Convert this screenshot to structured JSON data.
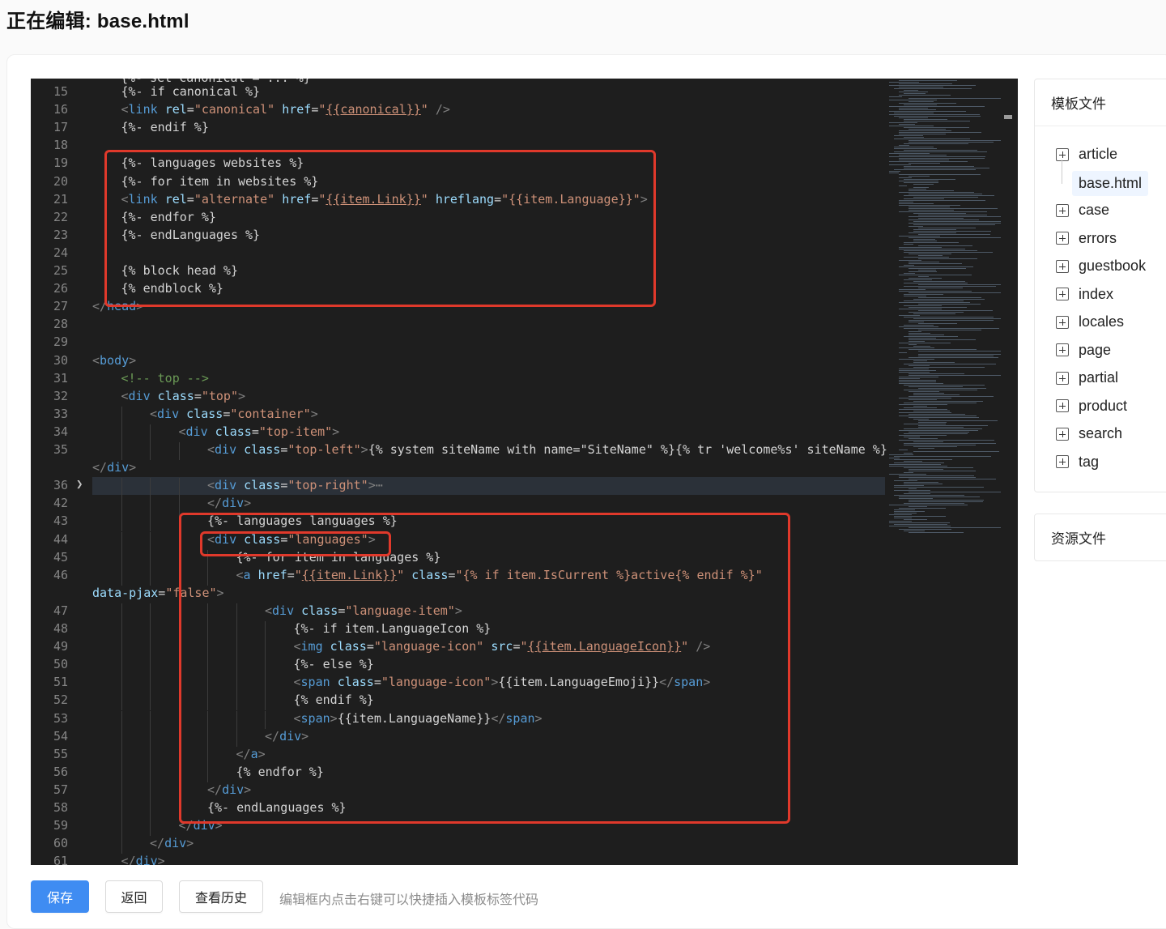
{
  "header": {
    "title": "正在编辑: base.html"
  },
  "editor": {
    "lines": [
      {
        "n": "15",
        "indent": 1,
        "html": "{%- if canonical %}"
      },
      {
        "n": "16",
        "indent": 1,
        "html": "<span class='p'>&lt;</span><span class='t'>link</span> <span class='a'>rel</span>=<span class='s'>\"canonical\"</span> <span class='a'>href</span>=<span class='s'>\"<span class='u'>{{canonical}}</span>\"</span> <span class='p'>/&gt;</span>"
      },
      {
        "n": "17",
        "indent": 1,
        "html": "{%- endif %}"
      },
      {
        "n": "18",
        "indent": 0,
        "html": ""
      },
      {
        "n": "19",
        "indent": 1,
        "html": "{%- languages websites %}"
      },
      {
        "n": "20",
        "indent": 1,
        "html": "{%- for item in websites %}"
      },
      {
        "n": "21",
        "indent": 1,
        "html": "<span class='p'>&lt;</span><span class='t'>link</span> <span class='a'>rel</span>=<span class='s'>\"alternate\"</span> <span class='a'>href</span>=<span class='s'>\"<span class='u'>{{item.Link}}</span>\"</span> <span class='a'>hreflang</span>=<span class='s'>\"{{item.Language}}\"</span><span class='p'>&gt;</span>"
      },
      {
        "n": "22",
        "indent": 1,
        "html": "{%- endfor %}"
      },
      {
        "n": "23",
        "indent": 1,
        "html": "{%- endLanguages %}"
      },
      {
        "n": "24",
        "indent": 0,
        "html": ""
      },
      {
        "n": "25",
        "indent": 1,
        "html": "{% block head %}"
      },
      {
        "n": "26",
        "indent": 1,
        "html": "{% endblock %}"
      },
      {
        "n": "27",
        "indent": 0,
        "html": "<span class='p'>&lt;/</span><span class='t'>head</span><span class='p'>&gt;</span>"
      },
      {
        "n": "28",
        "indent": 0,
        "html": ""
      },
      {
        "n": "29",
        "indent": 0,
        "html": ""
      },
      {
        "n": "30",
        "indent": 0,
        "html": "<span class='p'>&lt;</span><span class='t'>body</span><span class='p'>&gt;</span>"
      },
      {
        "n": "31",
        "indent": 1,
        "html": "<span class='c'>&lt;!-- top --&gt;</span>"
      },
      {
        "n": "32",
        "indent": 1,
        "html": "<span class='p'>&lt;</span><span class='t'>div</span> <span class='a'>class</span>=<span class='s'>\"top\"</span><span class='p'>&gt;</span>"
      },
      {
        "n": "33",
        "indent": 2,
        "html": "<span class='p'>&lt;</span><span class='t'>div</span> <span class='a'>class</span>=<span class='s'>\"container\"</span><span class='p'>&gt;</span>"
      },
      {
        "n": "34",
        "indent": 3,
        "html": "<span class='p'>&lt;</span><span class='t'>div</span> <span class='a'>class</span>=<span class='s'>\"top-item\"</span><span class='p'>&gt;</span>"
      },
      {
        "n": "35",
        "indent": 4,
        "html": "<span class='p'>&lt;</span><span class='t'>div</span> <span class='a'>class</span>=<span class='s'>\"top-left\"</span><span class='p'>&gt;</span>{% system siteName with name=\"SiteName\" %}{% tr 'welcome%s' siteName %}"
      },
      {
        "n": "",
        "indent": 0,
        "html": "<span class='p'>&lt;/</span><span class='t'>div</span><span class='p'>&gt;</span>"
      },
      {
        "n": "36",
        "indent": 4,
        "fold": true,
        "html": "<span class='p'>&lt;</span><span class='t'>div</span> <span class='a'>class</span>=<span class='s'>\"top-right\"</span><span class='p'>&gt;</span><span class='p'>⋯</span>"
      },
      {
        "n": "42",
        "indent": 4,
        "html": "<span class='p'>&lt;/</span><span class='t'>div</span><span class='p'>&gt;</span>"
      },
      {
        "n": "43",
        "indent": 4,
        "html": "{%- languages languages %}"
      },
      {
        "n": "44",
        "indent": 4,
        "html": "<span class='p'>&lt;</span><span class='t'>div</span> <span class='a'>class</span>=<span class='s'>\"languages\"</span><span class='p'>&gt;</span>"
      },
      {
        "n": "45",
        "indent": 5,
        "html": "{%- for item in languages %}"
      },
      {
        "n": "46",
        "indent": 5,
        "html": "<span class='p'>&lt;</span><span class='t'>a</span> <span class='a'>href</span>=<span class='s'>\"<span class='u'>{{item.Link}}</span>\"</span> <span class='a'>class</span>=<span class='s'>\"{% if item.IsCurrent %}active{% endif %}\"</span>"
      },
      {
        "n": "",
        "indent": 0,
        "html": "<span class='a'>data-pjax</span>=<span class='s'>\"false\"</span><span class='p'>&gt;</span>"
      },
      {
        "n": "47",
        "indent": 6,
        "html": "<span class='p'>&lt;</span><span class='t'>div</span> <span class='a'>class</span>=<span class='s'>\"language-item\"</span><span class='p'>&gt;</span>"
      },
      {
        "n": "48",
        "indent": 7,
        "html": "{%- if item.LanguageIcon %}"
      },
      {
        "n": "49",
        "indent": 7,
        "html": "<span class='p'>&lt;</span><span class='t'>img</span> <span class='a'>class</span>=<span class='s'>\"language-icon\"</span> <span class='a'>src</span>=<span class='s'>\"<span class='u'>{{item.LanguageIcon}}</span>\"</span> <span class='p'>/&gt;</span>"
      },
      {
        "n": "50",
        "indent": 7,
        "html": "{%- else %}"
      },
      {
        "n": "51",
        "indent": 7,
        "html": "<span class='p'>&lt;</span><span class='t'>span</span> <span class='a'>class</span>=<span class='s'>\"language-icon\"</span><span class='p'>&gt;</span>{{item.LanguageEmoji}}<span class='p'>&lt;/</span><span class='t'>span</span><span class='p'>&gt;</span>"
      },
      {
        "n": "52",
        "indent": 7,
        "html": "{% endif %}"
      },
      {
        "n": "53",
        "indent": 7,
        "html": "<span class='p'>&lt;</span><span class='t'>span</span><span class='p'>&gt;</span>{{item.LanguageName}}<span class='p'>&lt;/</span><span class='t'>span</span><span class='p'>&gt;</span>"
      },
      {
        "n": "54",
        "indent": 6,
        "html": "<span class='p'>&lt;/</span><span class='t'>div</span><span class='p'>&gt;</span>"
      },
      {
        "n": "55",
        "indent": 5,
        "html": "<span class='p'>&lt;/</span><span class='t'>a</span><span class='p'>&gt;</span>"
      },
      {
        "n": "56",
        "indent": 5,
        "html": "{% endfor %}"
      },
      {
        "n": "57",
        "indent": 4,
        "html": "<span class='p'>&lt;/</span><span class='t'>div</span><span class='p'>&gt;</span>"
      },
      {
        "n": "58",
        "indent": 4,
        "html": "{%- endLanguages %}"
      },
      {
        "n": "59",
        "indent": 3,
        "html": "<span class='p'>&lt;/</span><span class='t'>div</span><span class='p'>&gt;</span>"
      },
      {
        "n": "60",
        "indent": 2,
        "html": "<span class='p'>&lt;/</span><span class='t'>div</span><span class='p'>&gt;</span>"
      },
      {
        "n": "61",
        "indent": 1,
        "html": "<span class='p'>&lt;/</span><span class='t'>div</span><span class='p'>&gt;</span>"
      }
    ]
  },
  "sidebar": {
    "template_files_title": "模板文件",
    "tree": [
      {
        "label": "article",
        "type": "folder",
        "icon": "plus-square-icon"
      },
      {
        "label": "base.html",
        "type": "file"
      },
      {
        "label": "case",
        "type": "folder",
        "icon": "plus-square-icon"
      },
      {
        "label": "errors",
        "type": "folder",
        "icon": "plus-square-icon"
      },
      {
        "label": "guestbook",
        "type": "folder",
        "icon": "plus-square-icon"
      },
      {
        "label": "index",
        "type": "folder",
        "icon": "plus-square-icon"
      },
      {
        "label": "locales",
        "type": "folder",
        "icon": "plus-square-icon"
      },
      {
        "label": "page",
        "type": "folder",
        "icon": "plus-square-icon"
      },
      {
        "label": "partial",
        "type": "folder",
        "icon": "plus-square-icon"
      },
      {
        "label": "product",
        "type": "folder",
        "icon": "plus-square-icon"
      },
      {
        "label": "search",
        "type": "folder",
        "icon": "plus-square-icon"
      },
      {
        "label": "tag",
        "type": "folder",
        "icon": "plus-square-icon"
      }
    ],
    "resource_files_title": "资源文件"
  },
  "footer": {
    "save_label": "保存",
    "back_label": "返回",
    "history_label": "查看历史",
    "hint": "编辑框内点击右键可以快捷插入模板标签代码"
  },
  "colors": {
    "accent": "#3f8cf2",
    "highlight_box": "#e0392b",
    "editor_bg": "#1e1e1e"
  }
}
